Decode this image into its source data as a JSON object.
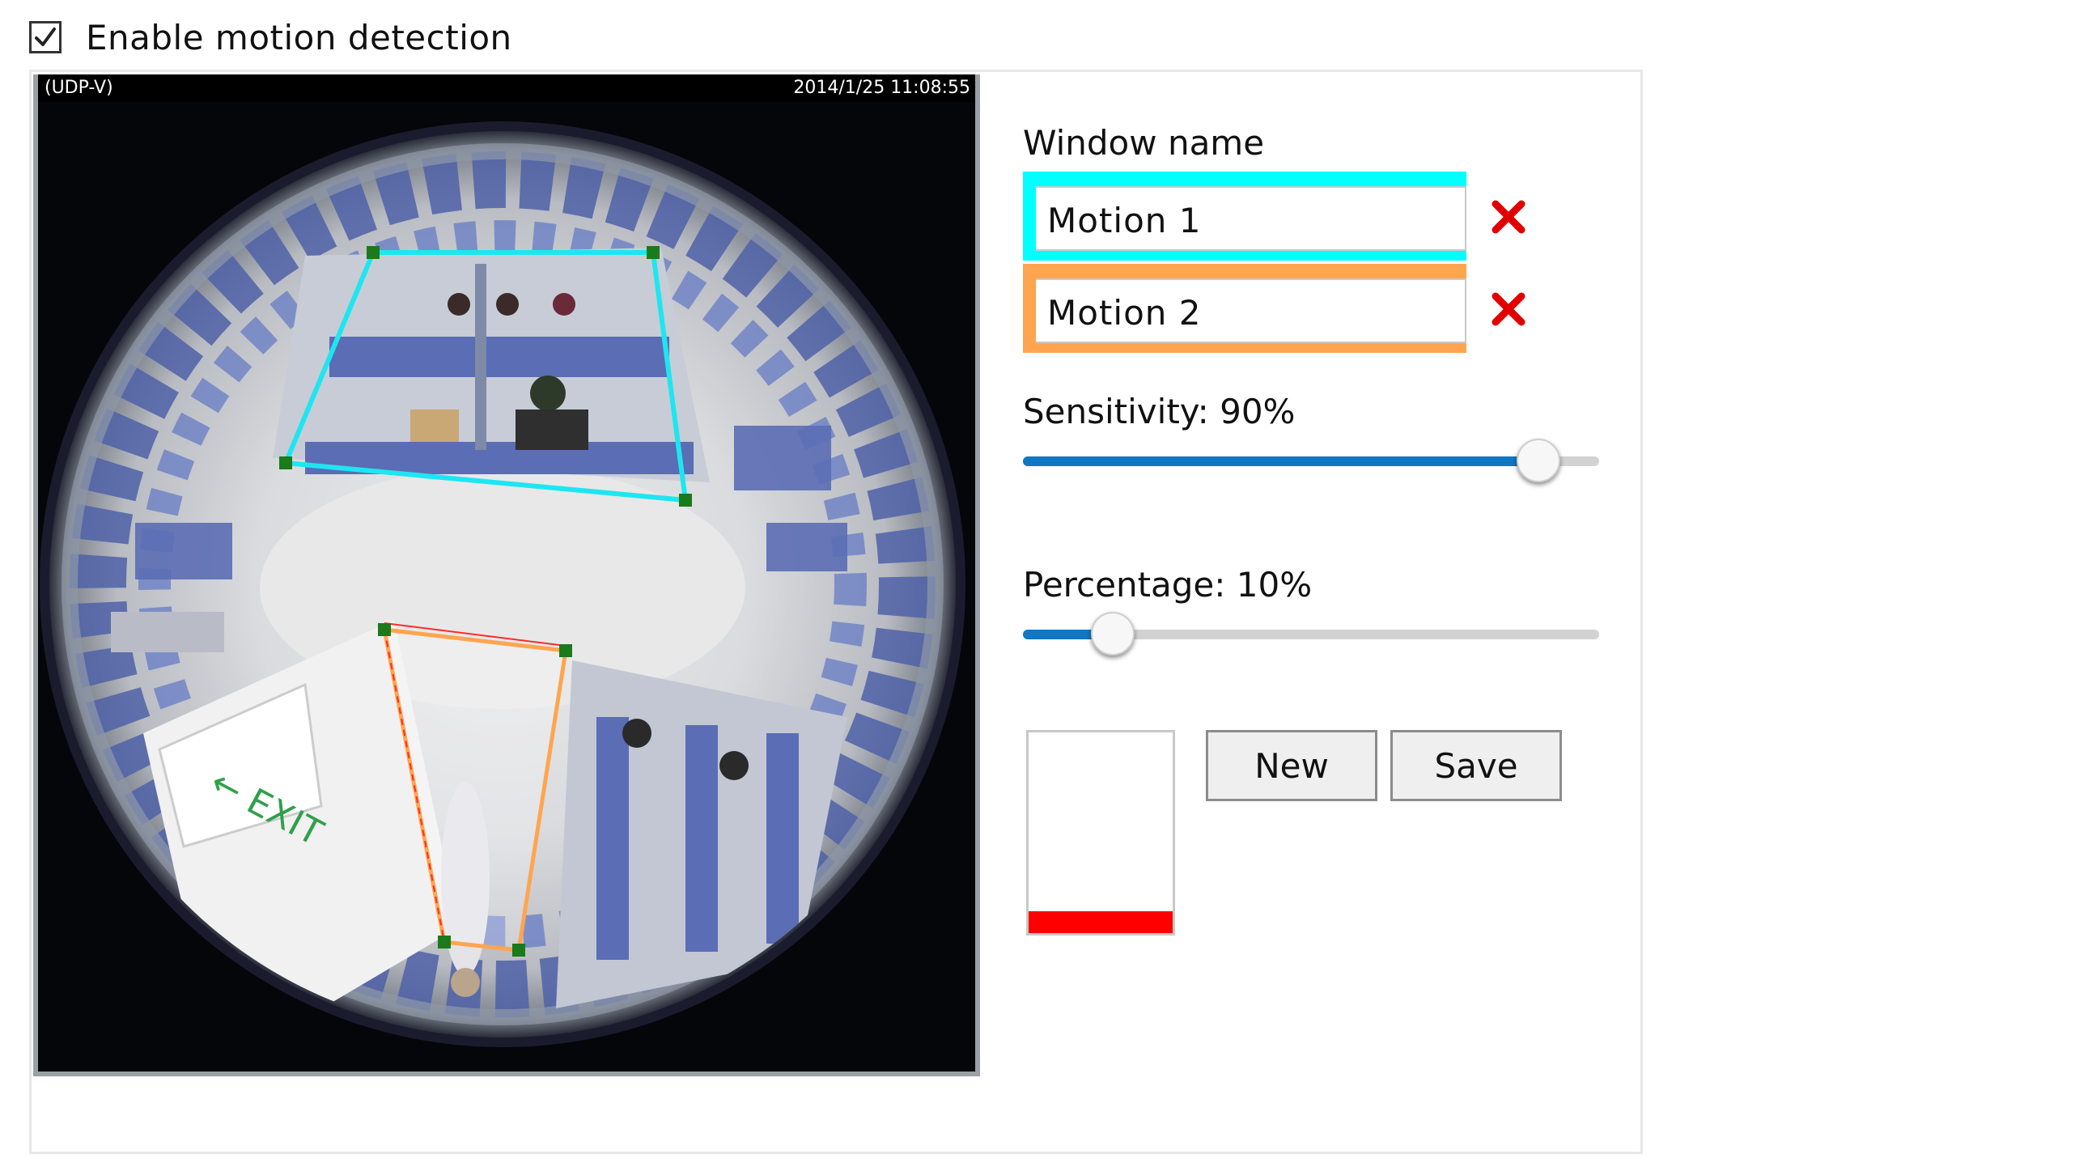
{
  "enable": {
    "label": "Enable motion detection",
    "checked": true
  },
  "video": {
    "protocol": "(UDP-V)",
    "timestamp": "2014/1/25 11:08:55"
  },
  "window_name": {
    "label": "Window name"
  },
  "motion_windows": [
    {
      "name": "Motion 1",
      "color": "#00ffff"
    },
    {
      "name": "Motion 2",
      "color": "#ffa54f"
    }
  ],
  "sensitivity": {
    "label": "Sensitivity:",
    "value_text": "90%",
    "value": 90
  },
  "percentage": {
    "label": "Percentage:",
    "value_text": "10%",
    "value": 10
  },
  "meter": {
    "level": 0.11,
    "color": "#ff0000"
  },
  "buttons": {
    "new_label": "New",
    "save_label": "Save"
  },
  "icons": {
    "delete": "delete-x-icon",
    "check": "check-icon"
  }
}
